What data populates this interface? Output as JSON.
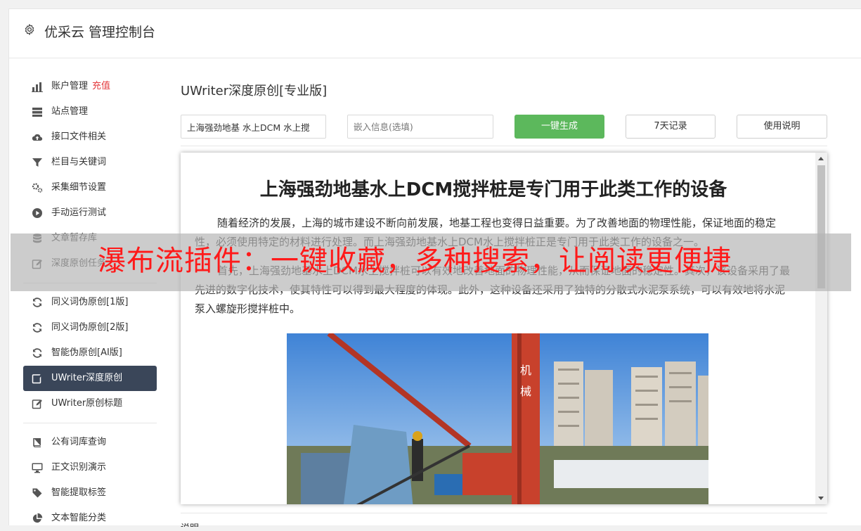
{
  "header": {
    "title": "优采云 管理控制台"
  },
  "sidebar": {
    "groups": [
      [
        {
          "label": "账户管理",
          "extra": "充值",
          "icon": "bar-chart-icon"
        },
        {
          "label": "站点管理",
          "icon": "server-icon"
        },
        {
          "label": "接口文件相关",
          "icon": "cloud-upload-icon"
        },
        {
          "label": "栏目与关键词",
          "icon": "filter-icon"
        },
        {
          "label": "采集细节设置",
          "icon": "cogs-icon"
        },
        {
          "label": "手动运行测试",
          "icon": "play-circle-icon"
        },
        {
          "label": "文章暂存库",
          "icon": "database-icon"
        },
        {
          "label": "深度原创任务",
          "icon": "edit-icon"
        }
      ],
      [
        {
          "label": "同义词伪原创[1版]",
          "icon": "refresh-icon"
        },
        {
          "label": "同义词伪原创[2版]",
          "icon": "refresh-icon"
        },
        {
          "label": "智能伪原创[AI版]",
          "icon": "refresh-icon"
        },
        {
          "label": "UWriter深度原创",
          "icon": "edit-icon",
          "active": true
        },
        {
          "label": "UWriter原创标题",
          "icon": "edit-icon"
        }
      ],
      [
        {
          "label": "公有词库查询",
          "icon": "book-icon"
        },
        {
          "label": "正文识别演示",
          "icon": "monitor-icon"
        },
        {
          "label": "智能提取标签",
          "icon": "tag-icon"
        },
        {
          "label": "文本智能分类",
          "icon": "pie-chart-icon"
        }
      ]
    ]
  },
  "main": {
    "page_title": "UWriter深度原创[专业版]",
    "keyword_input": {
      "value": "上海强劲地基 水上DCM 水上搅"
    },
    "embed_input": {
      "placeholder": "嵌入信息(选填)"
    },
    "generate_label": "一键生成",
    "history_label": "7天记录",
    "help_label": "使用说明",
    "article": {
      "title": "上海强劲地基水上DCM搅拌桩是专门用于此类工作的设备",
      "paragraphs": [
        "随着经济的发展，上海的城市建设不断向前发展，地基工程也变得日益重要。为了改善地面的物理性能，保证地面的稳定性，必须使用特定的材料进行处理。而上海强劲地基水上DCM水上搅拌桩正是专门用于此类工作的设备之一。",
        "首先，上海强劲地基水上DCM水上搅拌桩可以有效地改善地面的物理性能，从而保证地面的稳定性。其次，该设备采用了最先进的数字化技术，使其特性可以得到最大程度的体现。此外，这种设备还采用了独特的分散式水泥泵系统，可以有效地将水泥泵入螺旋形搅拌桩中。"
      ],
      "image_sign": "机械"
    },
    "bottom_label": "说明"
  },
  "overlay": {
    "text": "瀑布流插件：一键收藏，多种搜索，让阅读更便捷"
  },
  "colors": {
    "active_nav": "#3a4659",
    "primary_button": "#5cb85c",
    "recharge": "#e4393c",
    "overlay_text": "#ff1a1a"
  }
}
